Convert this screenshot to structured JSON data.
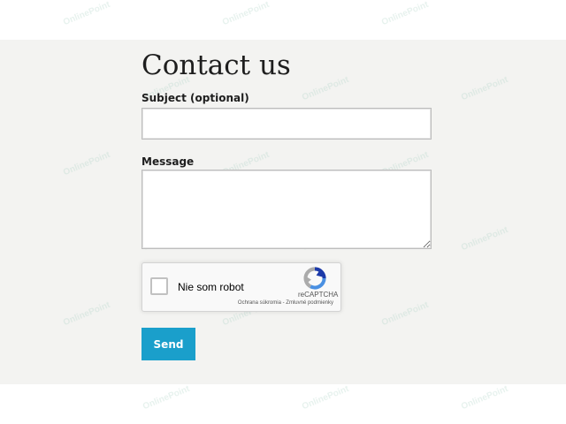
{
  "form": {
    "title": "Contact us",
    "subject_label": "Subject (optional)",
    "subject_value": "",
    "message_label": "Message",
    "message_value": "",
    "send_label": "Send"
  },
  "captcha": {
    "checkbox_label": "Nie som robot",
    "brand": "reCAPTCHA",
    "privacy_link": "Ochrana súkromia",
    "separator": " - ",
    "terms_link": "Zmluvné podmienky",
    "checked": false
  },
  "watermark": {
    "text": "OnlinePoint"
  },
  "colors": {
    "panel_background": "#f3f3f1",
    "send_button": "#1a9fcb",
    "captcha_blue": "#1c3aa9",
    "captcha_light_blue": "#4a90e2",
    "captcha_grey": "#ababab"
  }
}
